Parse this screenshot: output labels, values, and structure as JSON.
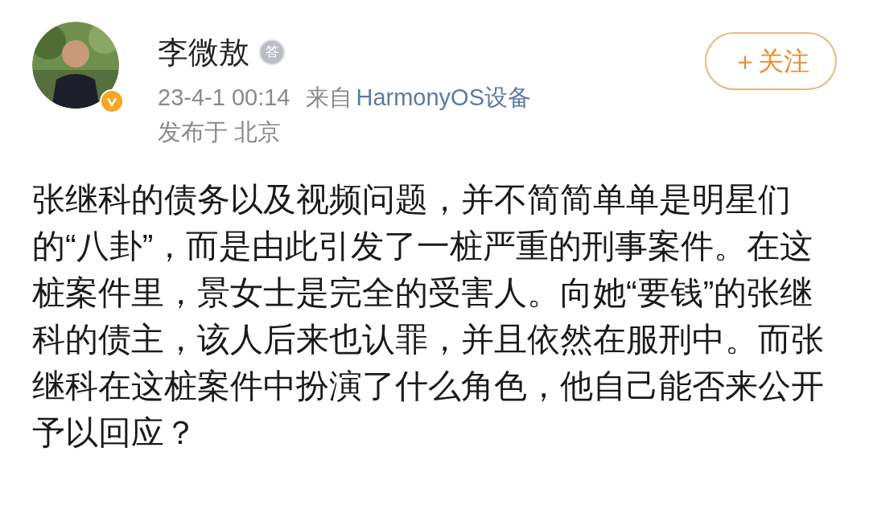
{
  "post": {
    "author": {
      "name": "李微敖",
      "badge": "答",
      "verified": true
    },
    "time": "23-4-1 00:14",
    "source_prefix": "来自",
    "source": "HarmonyOS设备",
    "location": "发布于 北京",
    "follow_button": "＋关注",
    "text": "张继科的债务以及视频问题，并不简简单单是明星们的“八卦”，而是由此引发了一桩严重的刑事案件。在这桩案件里，景女士是完全的受害人。向她“要钱”的张继科的债主，该人后来也认罪，并且依然在服刑中。而张继科在这桩案件中扮演了什么角色，他自己能否来公开予以回应？"
  }
}
